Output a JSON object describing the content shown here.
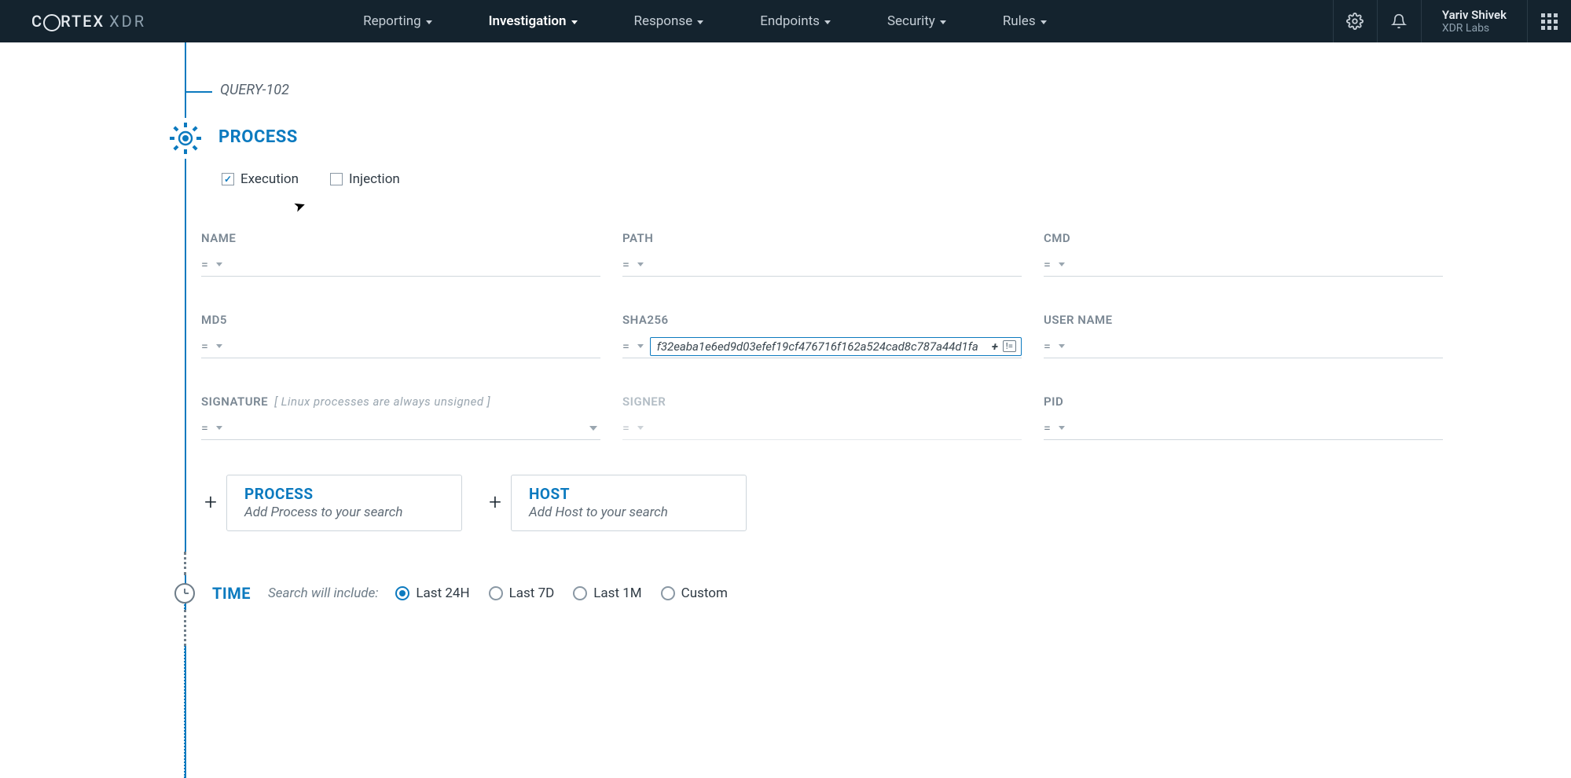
{
  "brand": {
    "name": "CORTEX",
    "suffix": "XDR"
  },
  "nav": {
    "items": [
      {
        "label": "Reporting"
      },
      {
        "label": "Investigation",
        "active": true
      },
      {
        "label": "Response"
      },
      {
        "label": "Endpoints"
      },
      {
        "label": "Security"
      },
      {
        "label": "Rules"
      }
    ]
  },
  "user": {
    "name": "Yariv Shivek",
    "org": "XDR Labs"
  },
  "query": {
    "id": "QUERY-102"
  },
  "process": {
    "title": "PROCESS",
    "checks": {
      "execution": "Execution",
      "injection": "Injection"
    },
    "fields": {
      "name_label": "NAME",
      "path_label": "PATH",
      "cmd_label": "CMD",
      "md5_label": "MD5",
      "sha256_label": "SHA256",
      "user_label": "USER NAME",
      "signature_label": "SIGNATURE",
      "signature_hint": "[ Linux processes are always unsigned ]",
      "signer_label": "SIGNER",
      "pid_label": "PID",
      "op_eq": "=",
      "sha256_value": "f32eaba1e6ed9d03efef19cf476716f162a524cad8c787a44d1fa",
      "sha256_badge_plus": "+",
      "sha256_badge_ne": "!="
    }
  },
  "add": {
    "process_title": "PROCESS",
    "process_sub": "Add Process to your search",
    "host_title": "HOST",
    "host_sub": "Add Host to your search"
  },
  "time": {
    "title": "TIME",
    "hint": "Search will include:",
    "options": [
      "Last 24H",
      "Last 7D",
      "Last 1M",
      "Custom"
    ]
  }
}
